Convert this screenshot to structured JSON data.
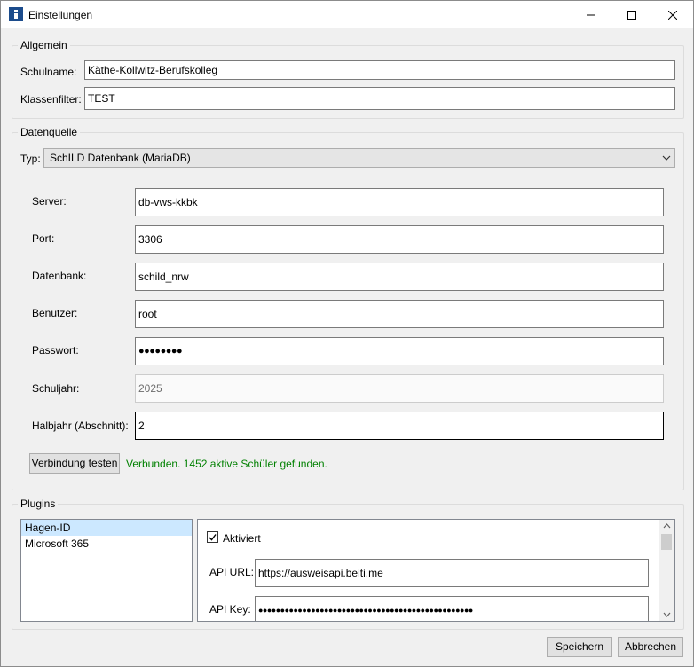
{
  "window": {
    "title": "Einstellungen"
  },
  "allgemein": {
    "legend": "Allgemein",
    "schulname_label": "Schulname:",
    "schulname_value": "Käthe-Kollwitz-Berufskolleg",
    "klassenfilter_label": "Klassenfilter:",
    "klassenfilter_value": "TEST"
  },
  "datenquelle": {
    "legend": "Datenquelle",
    "typ_label": "Typ:",
    "typ_value": "SchILD Datenbank (MariaDB)",
    "fields": [
      {
        "label": "Server:",
        "value": "db-vws-kkbk"
      },
      {
        "label": "Port:",
        "value": "3306"
      },
      {
        "label": "Datenbank:",
        "value": "schild_nrw"
      },
      {
        "label": "Benutzer:",
        "value": "root"
      },
      {
        "label": "Passwort:",
        "value": "●●●●●●●●"
      },
      {
        "label": "Schuljahr:",
        "value": "2025"
      },
      {
        "label": "Halbjahr (Abschnitt):",
        "value": "2"
      }
    ],
    "test_button": "Verbindung testen",
    "status": "Verbunden. 1452 aktive Schüler gefunden."
  },
  "plugins": {
    "legend": "Plugins",
    "items": [
      "Hagen-ID",
      "Microsoft 365"
    ],
    "aktiviert_label": "Aktiviert",
    "api_url_label": "API URL:",
    "api_url_value": "https://ausweisapi.beiti.me",
    "api_key_label": "API Key:",
    "api_key_value": "●●●●●●●●●●●●●●●●●●●●●●●●●●●●●●●●●●●●●●●●●●●●●●●●●"
  },
  "footer": {
    "save": "Speichern",
    "cancel": "Abbrechen"
  }
}
